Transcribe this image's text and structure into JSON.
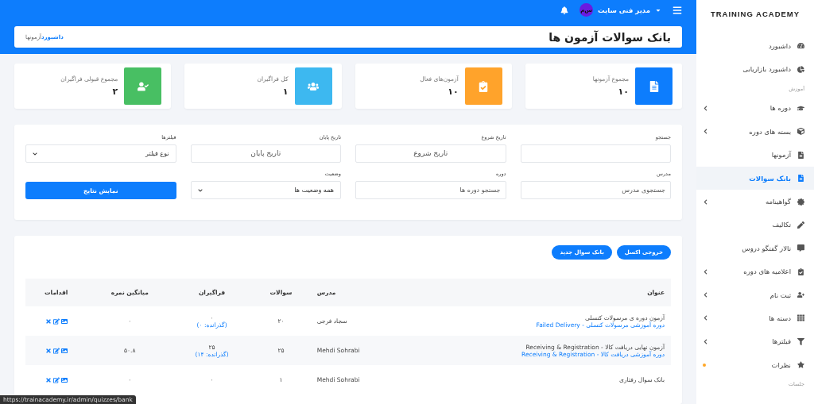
{
  "sidebar": {
    "brand": "TRAINING ACADEMY",
    "items": [
      {
        "kind": "link",
        "label": "داشبورد",
        "expandable": false,
        "selected": false
      },
      {
        "kind": "link",
        "label": "داشبورد بازاریابی",
        "expandable": false,
        "selected": false
      },
      {
        "kind": "section",
        "label": "آموزش"
      },
      {
        "kind": "link",
        "label": "دوره ها",
        "expandable": true,
        "selected": false
      },
      {
        "kind": "link",
        "label": "بسته های دوره",
        "expandable": true,
        "selected": false
      },
      {
        "kind": "link",
        "label": "آزمونها",
        "expandable": false,
        "selected": false
      },
      {
        "kind": "link",
        "label": "بانک سوالات",
        "expandable": false,
        "selected": true
      },
      {
        "kind": "link",
        "label": "گواهینامه",
        "expandable": true,
        "selected": false
      },
      {
        "kind": "link",
        "label": "تکالیف",
        "expandable": false,
        "selected": false
      },
      {
        "kind": "link",
        "label": "تالار گفتگو دروس",
        "expandable": false,
        "selected": false
      },
      {
        "kind": "link",
        "label": "اعلامیه های دوره",
        "expandable": true,
        "selected": false
      },
      {
        "kind": "link",
        "label": "ثبت نام",
        "expandable": true,
        "selected": false
      },
      {
        "kind": "link",
        "label": "دسته ها",
        "expandable": true,
        "selected": false
      },
      {
        "kind": "link",
        "label": "فیلترها",
        "expandable": true,
        "selected": false
      },
      {
        "kind": "link",
        "label": "نظرات",
        "expandable": false,
        "selected": false,
        "dot": true
      },
      {
        "kind": "section",
        "label": "جلسات"
      }
    ]
  },
  "topbar": {
    "user": "مدیر فنی سایت",
    "avatar": "س‌م"
  },
  "header": {
    "title": "بانک سوالات آزمون ها",
    "breadcrumb": [
      {
        "label": "داشبورد",
        "link": true
      },
      {
        "label": "آزمونها",
        "link": false
      }
    ]
  },
  "stats": [
    {
      "label": "مجموع آزمونها",
      "value": "۱۰",
      "color": "#0d7dfd"
    },
    {
      "label": "آزمون‌های فعال",
      "value": "۱۰",
      "color": "#ffa32b"
    },
    {
      "label": "کل فراگیران",
      "value": "۱",
      "color": "#3db8f0"
    },
    {
      "label": "مجموع قبولی فراگیران",
      "value": "۲",
      "color": "#48bf63"
    }
  ],
  "filters": [
    {
      "kind": "input",
      "label": "جستجو"
    },
    {
      "kind": "date",
      "label": "تاریخ شروع",
      "placeholder": "تاریخ شروع"
    },
    {
      "kind": "date",
      "label": "تاریخ پایان",
      "placeholder": "تاریخ پایان"
    },
    {
      "kind": "select",
      "label": "فیلترها",
      "value": "نوع فیلتر"
    },
    {
      "kind": "input",
      "label": "مدرس",
      "placeholder": "جستجوی مدرس"
    },
    {
      "kind": "input",
      "label": "دوره",
      "placeholder": "جستجو دوره ها"
    },
    {
      "kind": "select",
      "label": "وضعیت",
      "value": "همه وضعیت ها"
    },
    {
      "kind": "button",
      "label": "نمایش نتایج"
    }
  ],
  "actions": [
    "خروجی اکسل",
    "بانک سوال جدید"
  ],
  "table": {
    "columns": [
      "عنوان",
      "مدرس",
      "سوالات",
      "فراگیران",
      "میانگین نمره",
      "اقدامات"
    ],
    "rows": [
      {
        "title": "آزمون دوره ی مرسولات کنسلی",
        "course": "دوره آموزشی مرسولات کنسلی - Failed Delivery",
        "teacher": "سجاد فرجی",
        "questions": "۲۰",
        "learners": "۰",
        "passed": "(گذرانده: ۰)",
        "average": "۰"
      },
      {
        "title": "آزمون نهایی دریافت کالا - Receiving & Registration",
        "course": "دوره آموزشی دریافت کالا - Receiving & Registration",
        "teacher": "Mehdi Sohrabi",
        "questions": "۲۵",
        "learners": "۲۵",
        "passed": "(گذرانده: ۱۴)",
        "average": "۵۰.۸"
      },
      {
        "title": "بانک سوال رفتاری",
        "teacher": "Mehdi Sohrabi",
        "questions": "۱",
        "learners": "۰",
        "average": "۰"
      }
    ]
  },
  "status_url": "https://trainacademy.ir/admin/quizzes/bank"
}
